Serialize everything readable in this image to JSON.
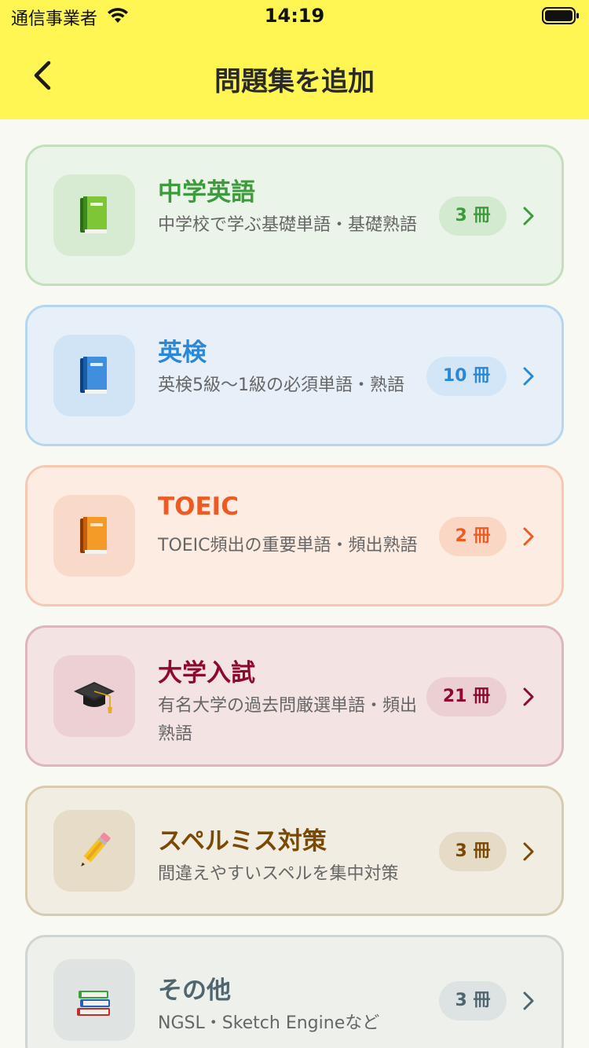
{
  "status_bar": {
    "carrier": "通信事業者",
    "time": "14:19"
  },
  "nav": {
    "title": "問題集を追加"
  },
  "colors": {
    "header": "#fff553",
    "background": "#f9f9f3"
  },
  "categories": [
    {
      "title": "中学英語",
      "description": "中学校で学ぶ基礎単語・基礎熟語",
      "count": "3 冊",
      "icon": "green-book-icon",
      "accent": "#3d9a3d",
      "card_bg": "#ebf4e8",
      "border": "#c4dfbd",
      "icon_bg": "#d7ebd2",
      "badge_bg": "#d4ead0"
    },
    {
      "title": "英検",
      "description": "英検5級〜1級の必須単語・熟語",
      "count": "10 冊",
      "icon": "blue-book-icon",
      "accent": "#2a88d6",
      "card_bg": "#e7f0f8",
      "border": "#b6d6ef",
      "icon_bg": "#d0e4f5",
      "badge_bg": "#d2e6f7"
    },
    {
      "title": "TOEIC",
      "description": "TOEIC頻出の重要単語・頻出熟語",
      "count": "2 冊",
      "icon": "orange-book-icon",
      "accent": "#ef5a22",
      "card_bg": "#fcece2",
      "border": "#f6c8b4",
      "icon_bg": "#f9d9c9",
      "badge_bg": "#fad7c5"
    },
    {
      "title": "大学入試",
      "description": "有名大学の過去問厳選単語・頻出熟語",
      "count": "21 冊",
      "icon": "graduation-cap-icon",
      "accent": "#8c0a2c",
      "card_bg": "#f3e3e3",
      "border": "#ddb5bd",
      "icon_bg": "#ecd0d3",
      "badge_bg": "#ebcfd3"
    },
    {
      "title": "スペルミス対策",
      "description": "間違えやすいスペルを集中対策",
      "count": "3 冊",
      "icon": "pencil-icon",
      "accent": "#7a4a04",
      "card_bg": "#f2ede2",
      "border": "#d8cbb0",
      "icon_bg": "#e6dcc8",
      "badge_bg": "#e6dbc6"
    },
    {
      "title": "その他",
      "description": "NGSL・Sketch Engineなど",
      "count": "3 冊",
      "icon": "books-stack-icon",
      "accent": "#4f6670",
      "card_bg": "#eef0ec",
      "border": "#cfd5d3",
      "icon_bg": "#dfe3e2",
      "badge_bg": "#dde2e3"
    }
  ]
}
